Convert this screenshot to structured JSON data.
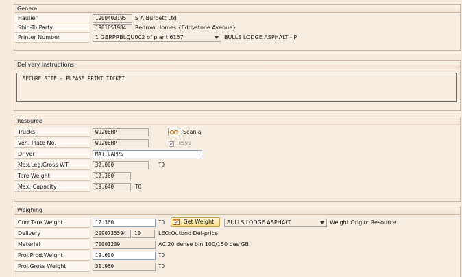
{
  "general": {
    "header": "General",
    "haulier": {
      "label": "Haulier",
      "code": "1900403195",
      "name": "S A Burdett Ltd"
    },
    "ship_to": {
      "label": "Ship-To Party",
      "code": "1901851984",
      "name": "Redrow Homes {Eddystone Avenue}"
    },
    "printer": {
      "label": "Printer Number",
      "value": "1 GBRPRBLQU002 of plant 6157",
      "desc": "BULLS LODGE ASPHALT - P"
    }
  },
  "delivery_instructions": {
    "header": "Delivery Instructions",
    "text": "SECURE SITE - PLEASE PRINT TICKET"
  },
  "resource": {
    "header": "Resource",
    "trucks": {
      "label": "Trucks",
      "value": "WU20BHP",
      "make": "Scania"
    },
    "plate": {
      "label": "Veh. Plate No.",
      "value": "WU20BHP",
      "checkbox_label": "Tesys",
      "checked": true
    },
    "driver": {
      "label": "Driver",
      "value": "MATTCAPPS"
    },
    "max_leg_gross": {
      "label": "Max.Leg.Gross WT",
      "value": "32.000",
      "unit": "TO"
    },
    "tare": {
      "label": "Tare Weight",
      "value": "12.360"
    },
    "max_capacity": {
      "label": "Max. Capacity",
      "value": "19.640",
      "unit": "TO"
    }
  },
  "weighing": {
    "header": "Weighing",
    "curr_tare": {
      "label": "Curr.Tare Weight",
      "value": "12.360",
      "unit": "TO"
    },
    "get_weight_label": "Get Weight",
    "scale_value": "BULLS LODGE ASPHALT",
    "weight_origin": "Weight Origin: Resource",
    "delivery": {
      "label": "Delivery",
      "code": "2090735594",
      "item": "10",
      "desc": "LEO:Outbnd Del-price"
    },
    "material": {
      "label": "Material",
      "code": "70001209",
      "desc": "AC 20 dense bin 100/150 des GB"
    },
    "proj_prod": {
      "label": "Proj.Prod.Weight",
      "value": "19.600",
      "unit": "TO"
    },
    "proj_gross": {
      "label": "Proj.Gross Weight",
      "value": "31.960",
      "unit": "TO"
    }
  }
}
